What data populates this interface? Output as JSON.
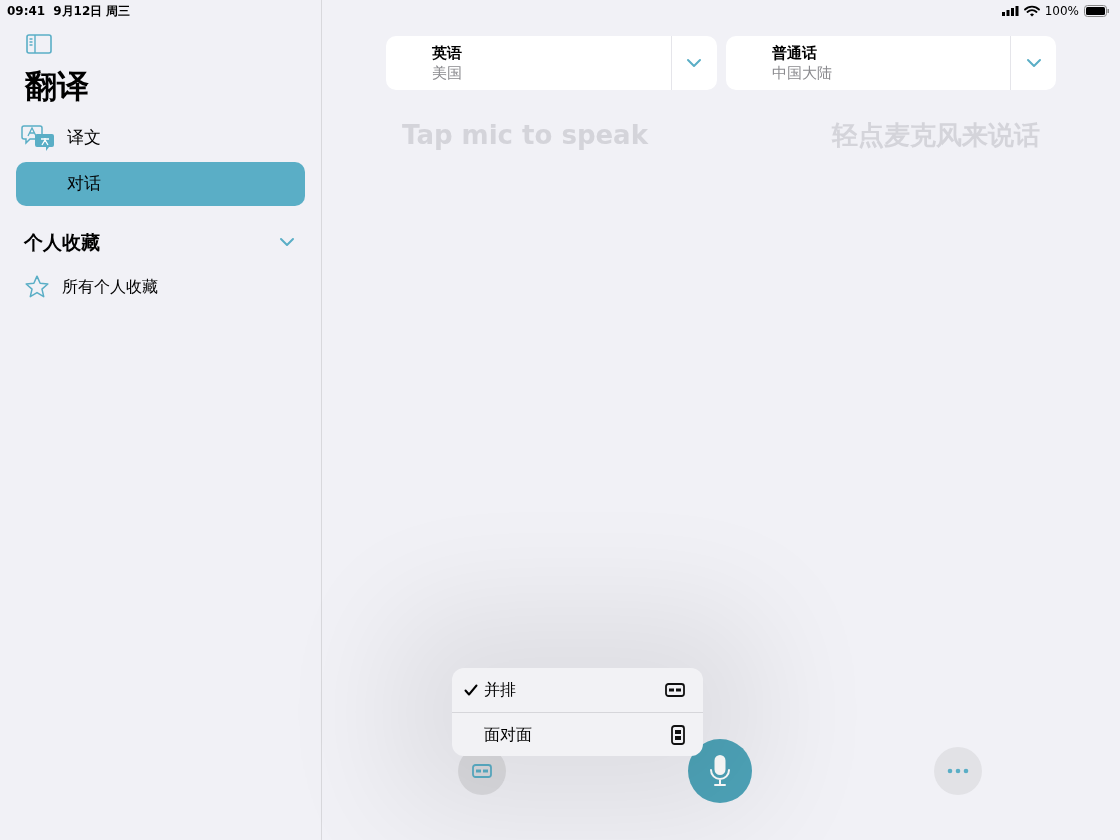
{
  "status_bar": {
    "time": "09:41",
    "date": "9月12日 周三",
    "battery": "100%"
  },
  "sidebar": {
    "title": "翻译",
    "items": [
      {
        "label": "译文",
        "kind": "translate",
        "selected": false
      },
      {
        "label": "对话",
        "kind": "plain",
        "selected": true
      }
    ],
    "favorites": {
      "title": "个人收藏",
      "expanded": true,
      "items": [
        {
          "label": "所有个人收藏"
        }
      ]
    }
  },
  "languages": [
    {
      "name": "英语",
      "region": "美国"
    },
    {
      "name": "普通话",
      "region": "中国大陆"
    }
  ],
  "prompts": [
    "Tap mic to speak",
    "轻点麦克风来说话"
  ],
  "layout_menu": [
    {
      "label": "并排",
      "kind": "side_by_side",
      "checked": true
    },
    {
      "label": "面对面",
      "kind": "face_to_face",
      "checked": false
    }
  ]
}
